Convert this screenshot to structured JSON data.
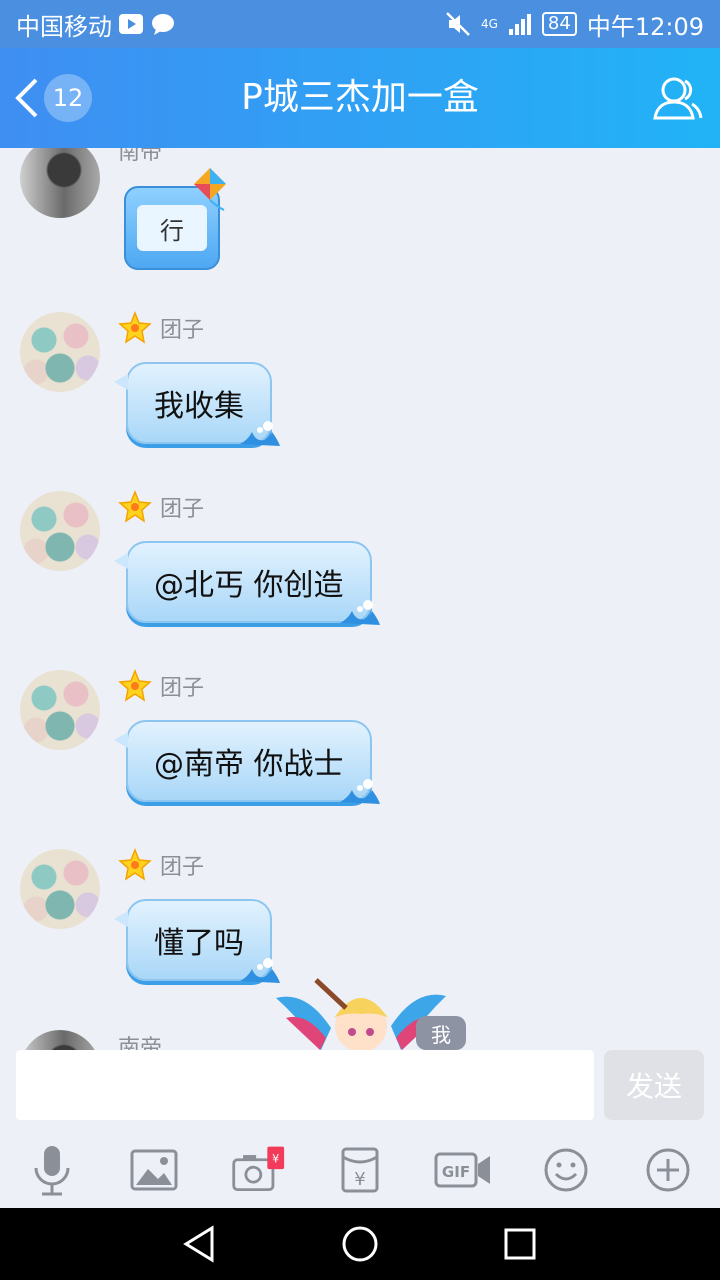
{
  "status": {
    "carrier": "中国移动",
    "network": "4G",
    "battery": "84",
    "time": "中午12:09"
  },
  "header": {
    "unread": "12",
    "title": "P城三杰加一盒"
  },
  "messages": [
    {
      "sender": "南帝",
      "text": "行",
      "type": "sticker"
    },
    {
      "sender": "团子",
      "text": "我收集"
    },
    {
      "sender": "团子",
      "text": "@北丐 你创造"
    },
    {
      "sender": "团子",
      "text": "@南帝 你战士"
    },
    {
      "sender": "团子",
      "text": "懂了吗"
    },
    {
      "sender": "南帝",
      "text": ""
    }
  ],
  "me_label": "我",
  "input": {
    "placeholder": "",
    "value": ""
  },
  "send_label": "发送",
  "toolbar": [
    "mic-icon",
    "image-icon",
    "red-packet-camera-icon",
    "red-packet-icon",
    "gif-icon",
    "emoji-icon",
    "plus-icon"
  ],
  "colors": {
    "header_start": "#3f8ef2",
    "header_end": "#21b3f6",
    "bubble": "#a9d7f8",
    "background": "#eef0f7"
  }
}
